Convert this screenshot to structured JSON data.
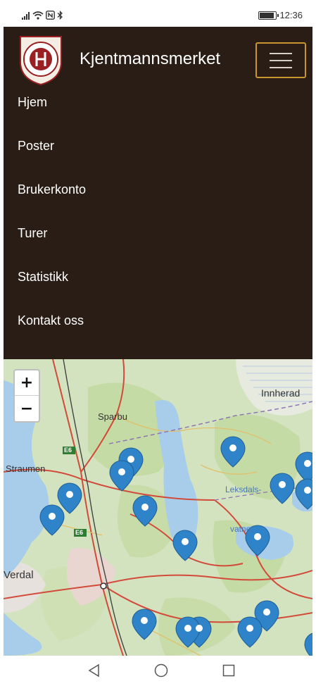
{
  "status": {
    "time": "12:36",
    "icons": [
      "signal-icon",
      "wifi-icon",
      "nfc-icon",
      "bluetooth-icon",
      "battery-icon"
    ]
  },
  "header": {
    "brand": "Kjentmannsmerket",
    "logo_icon": "club-logo-icon",
    "menu_icon": "hamburger-icon",
    "toggle_border_color": "#c9952f",
    "background_color": "#2a1d15"
  },
  "menu": {
    "items": [
      {
        "label": "Hjem"
      },
      {
        "label": "Poster"
      },
      {
        "label": "Brukerkonto"
      },
      {
        "label": "Turer"
      },
      {
        "label": "Statistikk"
      },
      {
        "label": "Kontakt oss"
      }
    ]
  },
  "map": {
    "zoom_in": "+",
    "zoom_out": "−",
    "marker_color": "#2f83c9",
    "labels": {
      "innherad": "Innherad",
      "sparbu": "Sparbu",
      "straumen": "Straumen",
      "verdal": "Verdal",
      "leksdals": "Leksdals-",
      "vatnet": "vatnet",
      "e6_top": "E6",
      "e6_bottom": "E6"
    }
  },
  "navbar": {
    "back_icon": "back-triangle-icon",
    "home_icon": "home-circle-icon",
    "recent_icon": "recent-square-icon"
  }
}
